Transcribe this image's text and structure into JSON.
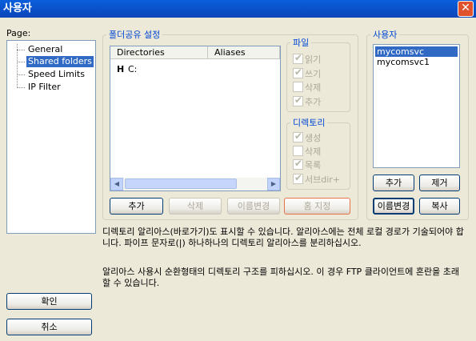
{
  "window": {
    "title": "사용자"
  },
  "sidebar": {
    "page_label": "Page:",
    "items": [
      {
        "label": "General"
      },
      {
        "label": "Shared folders"
      },
      {
        "label": "Speed Limits"
      },
      {
        "label": "IP Filter"
      }
    ],
    "ok_label": "확인",
    "cancel_label": "취소"
  },
  "shared": {
    "group_title": "폴더공유 설정",
    "columns": [
      "Directories",
      "Aliases"
    ],
    "rows": [
      {
        "marker": "H",
        "path": "C:"
      }
    ],
    "buttons": {
      "add": "추가",
      "delete": "삭제",
      "rename": "이름변경",
      "set_home": "홈 지정"
    }
  },
  "files": {
    "title": "파일",
    "options": [
      {
        "label": "읽기",
        "checked": true
      },
      {
        "label": "쓰기",
        "checked": true
      },
      {
        "label": "삭제",
        "checked": false
      },
      {
        "label": "추가",
        "checked": true
      }
    ]
  },
  "dirs": {
    "title": "디렉토리",
    "options": [
      {
        "label": "생성",
        "checked": true
      },
      {
        "label": "삭제",
        "checked": false
      },
      {
        "label": "목록",
        "checked": true
      },
      {
        "label": "서브dir+",
        "checked": true
      }
    ]
  },
  "users": {
    "title": "사용자",
    "items": [
      "mycomsvc",
      "mycomsvc1"
    ],
    "buttons": {
      "add": "추가",
      "remove": "제거",
      "rename": "이름변경",
      "copy": "복사"
    }
  },
  "help": {
    "para1": "디렉토리 알리아스(바로가기)도 표시할 수 있습니다. 알리아스에는 전체 로컬 경로가 기술되어야 합니다. 파이프 문자로(|) 하나하나의 디렉토리 알리아스를 분리하십시오.",
    "para2": "알리아스 사용시 순환형태의 디렉토리 구조를 피하십시오. 이 경우 FTP 클라이언트에 혼란을 초래할 수 있습니다."
  }
}
